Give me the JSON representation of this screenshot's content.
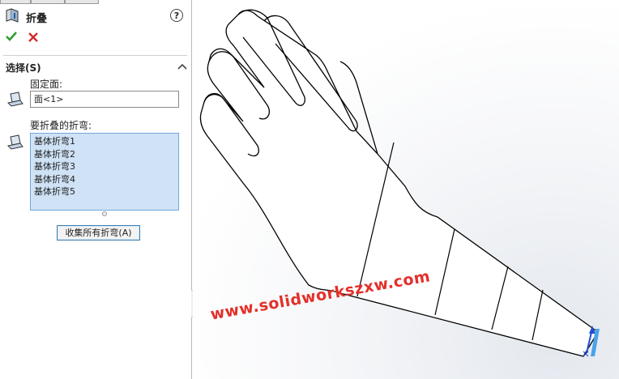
{
  "feature": {
    "title": "折叠",
    "help_label": "?"
  },
  "actions": {
    "ok": "check-icon",
    "cancel": "close-icon"
  },
  "selection": {
    "section_title": "选择(S)",
    "fixed_face_label": "固定面:",
    "fixed_face_value": "面<1>",
    "bends_label": "要折叠的折弯:",
    "bends": [
      "基体折弯1",
      "基体折弯2",
      "基体折弯3",
      "基体折弯4",
      "基体折弯5"
    ],
    "collect_button": "收集所有折弯(A)"
  },
  "watermark": "www.solidworkszxw.com",
  "colors": {
    "accent": "#3c7fb1",
    "list_bg": "#cfe2f6",
    "watermark": "#e3302a"
  }
}
